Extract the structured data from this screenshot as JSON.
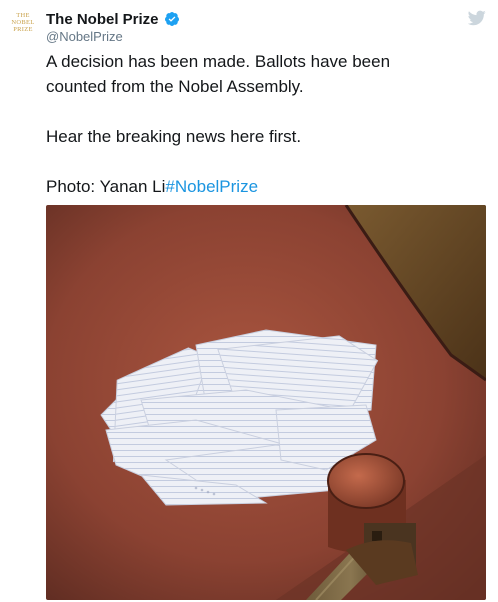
{
  "tweet": {
    "avatar_lines": [
      "THE",
      "NOBEL",
      "PRIZE"
    ],
    "display_name": "The Nobel Prize",
    "handle": "@NobelPrize",
    "text_line1": "A decision has been made. Ballots have been",
    "text_line2": "counted from the Nobel Assembly.",
    "text_line3": "Hear the breaking news here first.",
    "photo_credit": "Photo: Yanan Li",
    "hashtag": "#NobelPrize"
  },
  "icons": {
    "verified": "verified-badge-icon",
    "platform": "bird-logo-icon"
  },
  "colors": {
    "brand_gold": "#c9a14a",
    "link_blue": "#1b95e0",
    "verified_blue": "#1da1f2",
    "handle_grey": "#657786",
    "bird_grey": "#ccd6dd"
  }
}
